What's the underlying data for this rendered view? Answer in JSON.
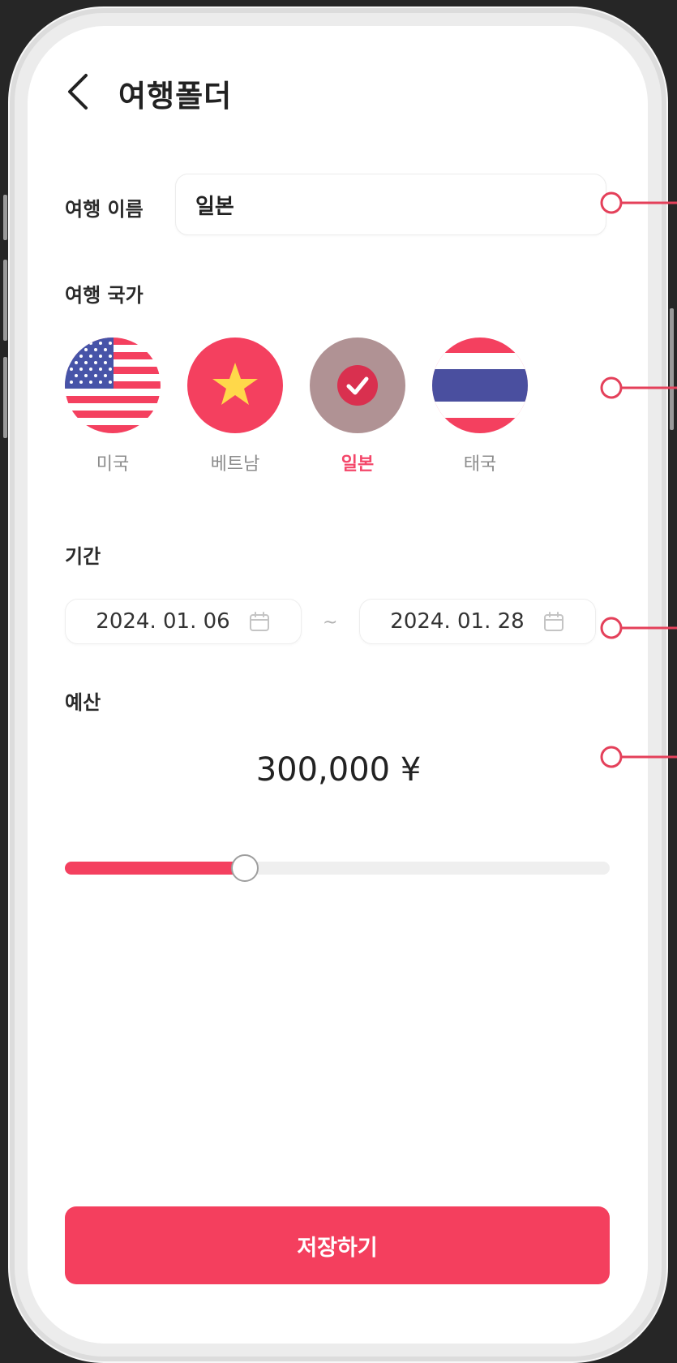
{
  "header": {
    "title": "여행폴더"
  },
  "trip_name": {
    "label": "여행 이름",
    "value": "일본"
  },
  "countries": {
    "label": "여행 국가",
    "items": [
      {
        "name": "미국",
        "selected": false
      },
      {
        "name": "베트남",
        "selected": false
      },
      {
        "name": "일본",
        "selected": true
      },
      {
        "name": "태국",
        "selected": false
      }
    ]
  },
  "period": {
    "label": "기간",
    "start": "2024. 01. 06",
    "separator": "~",
    "end": "2024. 01. 28"
  },
  "budget": {
    "label": "예산",
    "amount": "300,000 ¥",
    "slider_fraction": 0.33
  },
  "save_label": "저장하기",
  "colors": {
    "accent": "#f43f5e",
    "selected_country_bg": "#b09294"
  }
}
